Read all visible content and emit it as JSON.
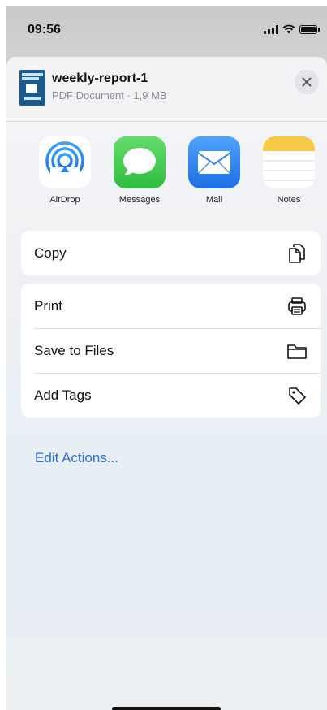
{
  "status_bar": {
    "time": "09:56",
    "icons": [
      "signal-icon",
      "wifi-icon",
      "battery-icon"
    ]
  },
  "file": {
    "name": "weekly-report-1",
    "meta": "PDF Document · 1,9 MB"
  },
  "apps": [
    {
      "label": "AirDrop",
      "icon": "airdrop-icon"
    },
    {
      "label": "Messages",
      "icon": "messages-icon"
    },
    {
      "label": "Mail",
      "icon": "mail-icon"
    },
    {
      "label": "Notes",
      "icon": "notes-icon"
    }
  ],
  "actions_primary": [
    {
      "label": "Copy",
      "icon": "copy-icon"
    }
  ],
  "actions_secondary": [
    {
      "label": "Print",
      "icon": "print-icon"
    },
    {
      "label": "Save to Files",
      "icon": "folder-icon"
    },
    {
      "label": "Add Tags",
      "icon": "tag-icon"
    }
  ],
  "edit_actions_label": "Edit Actions...",
  "colors": {
    "accent": "#2d6fd6",
    "messages": "#45c455",
    "mail": "#2f7df0",
    "notes": "#f7c948"
  }
}
